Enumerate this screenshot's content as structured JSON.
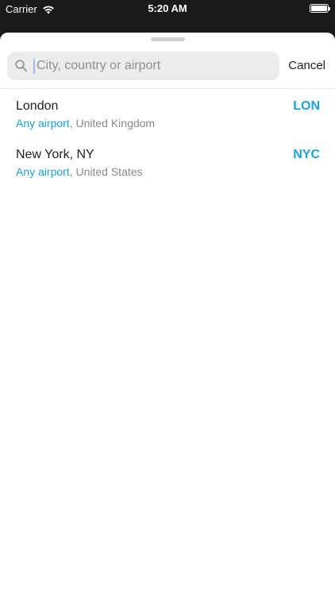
{
  "status_bar": {
    "carrier": "Carrier",
    "time": "5:20 AM"
  },
  "search": {
    "placeholder": "City, country or airport",
    "value": "",
    "cancel_label": "Cancel"
  },
  "results": [
    {
      "name": "London",
      "airport_label": "Any airport",
      "country": ", United Kingdom",
      "code": "LON"
    },
    {
      "name": "New York, NY",
      "airport_label": "Any airport",
      "country": ", United States",
      "code": "NYC"
    }
  ],
  "colors": {
    "accent": "#1da1d6",
    "background_dark": "#1a1a1a",
    "sheet": "#ffffff"
  }
}
